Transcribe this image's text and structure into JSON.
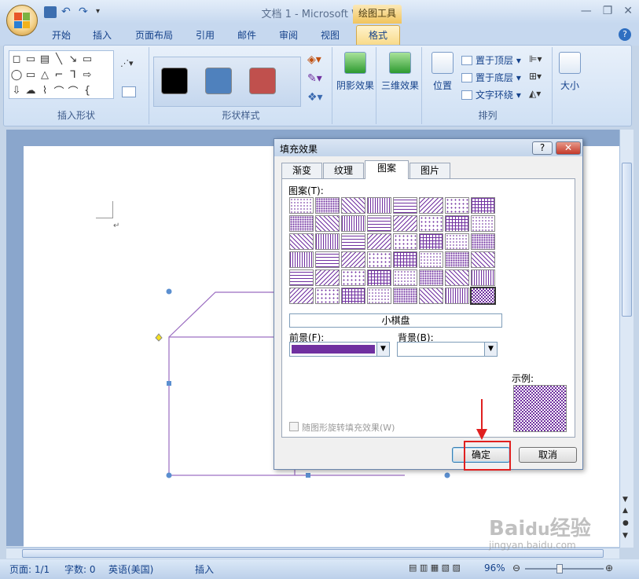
{
  "window": {
    "title": "文档 1 - Microsoft Word",
    "tools_tab": "绘图工具"
  },
  "tabs": [
    "开始",
    "插入",
    "页面布局",
    "引用",
    "邮件",
    "审阅",
    "视图",
    "格式"
  ],
  "active_tab": "格式",
  "ribbon": {
    "insert_shapes": {
      "label": "插入形状",
      "shape_glyphs": [
        "◻",
        "▭",
        "▭",
        "╲",
        "╲",
        "▭",
        "",
        "◯",
        "▭",
        "△",
        "⌐",
        "⅂",
        "⇨",
        "",
        "⇩",
        "⌒",
        "⌇",
        "⌒",
        "⌒",
        "{",
        ""
      ]
    },
    "shape_styles": {
      "label": "形状样式",
      "swatches": [
        "#000000",
        "#4f81bd",
        "#c0504d"
      ]
    },
    "shadow_effects": {
      "label": "阴影效果"
    },
    "threed_effects": {
      "label": "三维效果"
    },
    "arrange": {
      "label": "排列",
      "position": "位置",
      "bring_front": "置于顶层",
      "send_back": "置于底层",
      "text_wrap": "文字环绕"
    },
    "size": {
      "label": "大小"
    }
  },
  "dialog": {
    "title": "填充效果",
    "help": "?",
    "close": "✕",
    "tabs": [
      "渐变",
      "纹理",
      "图案",
      "图片"
    ],
    "active_tab": "图案",
    "pattern_label": "图案(T):",
    "selected_pattern_name": "小棋盘",
    "foreground_label": "前景(F):",
    "foreground_color": "#7030a0",
    "background_label": "背景(B):",
    "background_color": "#ffffff",
    "sample_label": "示例:",
    "rotate_checkbox": "随图形旋转填充效果(W)",
    "ok": "确定",
    "cancel": "取消"
  },
  "statusbar": {
    "page": "页面: 1/1",
    "words": "字数: 0",
    "language": "英语(美国)",
    "mode": "插入",
    "zoom": "96%"
  },
  "watermark": "Baidu经验 jingyan.baidu.com"
}
